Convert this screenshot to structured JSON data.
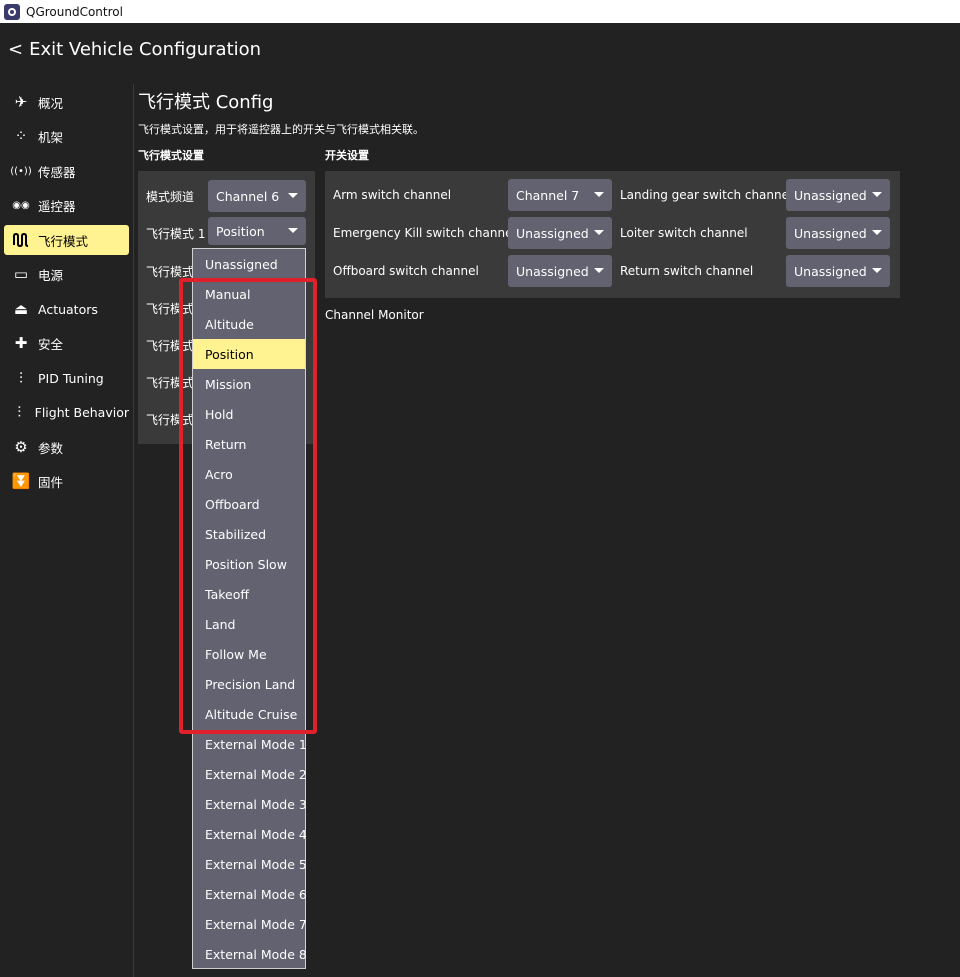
{
  "window": {
    "title": "QGroundControl"
  },
  "header": {
    "exit_chevron": "<",
    "exit_label": "Exit Vehicle Configuration"
  },
  "sidebar": {
    "items": [
      {
        "label": "概况",
        "icon": "paper-plane-icon",
        "glyph": "✈"
      },
      {
        "label": "机架",
        "icon": "airframe-dots-icon",
        "glyph": "⁘"
      },
      {
        "label": "传感器",
        "icon": "sensor-radio-icon",
        "glyph": "((•))"
      },
      {
        "label": "遥控器",
        "icon": "radio-controller-icon",
        "glyph": "◉◉"
      },
      {
        "label": "飞行模式",
        "icon": "flight-modes-wave-icon",
        "glyph": "ꟽ",
        "active": true
      },
      {
        "label": "电源",
        "icon": "battery-icon",
        "glyph": "▭"
      },
      {
        "label": "Actuators",
        "icon": "actuators-icon",
        "glyph": "⏏"
      },
      {
        "label": "安全",
        "icon": "safety-medkit-icon",
        "glyph": "✚"
      },
      {
        "label": "PID Tuning",
        "icon": "pid-sliders-icon",
        "glyph": "⫶"
      },
      {
        "label": "Flight Behavior",
        "icon": "flight-behavior-sliders-icon",
        "glyph": "⫶"
      },
      {
        "label": "参数",
        "icon": "parameters-gears-icon",
        "glyph": "⚙"
      },
      {
        "label": "固件",
        "icon": "firmware-icon",
        "glyph": "⏬"
      }
    ]
  },
  "main": {
    "title": "飞行模式 Config",
    "description": "飞行模式设置，用于将遥控器上的开关与飞行模式相关联。",
    "mode_section_label": "飞行模式设置",
    "switch_section_label": "开关设置",
    "mode_channel": {
      "label": "模式频道",
      "value": "Channel 6"
    },
    "flight_mode_rows": [
      {
        "label": "飞行模式 1",
        "value": "Position"
      },
      {
        "label": "飞行模式 2"
      },
      {
        "label": "飞行模式 3"
      },
      {
        "label": "飞行模式 4"
      },
      {
        "label": "飞行模式 5"
      },
      {
        "label": "飞行模式 6"
      }
    ],
    "switches": [
      {
        "label": "Arm switch channel",
        "value": "Channel 7"
      },
      {
        "label": "Landing gear switch channel",
        "value": "Unassigned"
      },
      {
        "label": "Emergency Kill switch channel",
        "value": "Unassigned"
      },
      {
        "label": "Loiter switch channel",
        "value": "Unassigned"
      },
      {
        "label": "Offboard switch channel",
        "value": "Unassigned"
      },
      {
        "label": "Return switch channel",
        "value": "Unassigned"
      }
    ],
    "channel_monitor_label": "Channel Monitor"
  },
  "dropdown": {
    "selected": "Position",
    "options": [
      "Unassigned",
      "Manual",
      "Altitude",
      "Position",
      "Mission",
      "Hold",
      "Return",
      "Acro",
      "Offboard",
      "Stabilized",
      "Position Slow",
      "Takeoff",
      "Land",
      "Follow Me",
      "Precision Land",
      "Altitude Cruise",
      "External Mode 1",
      "External Mode 2",
      "External Mode 3",
      "External Mode 4",
      "External Mode 5",
      "External Mode 6",
      "External Mode 7",
      "External Mode 8"
    ]
  },
  "colors": {
    "background": "#222222",
    "panel": "#3a3a3a",
    "combo": "#626270",
    "accent_selected": "#fff291",
    "highlight_box": "#e0202a"
  }
}
